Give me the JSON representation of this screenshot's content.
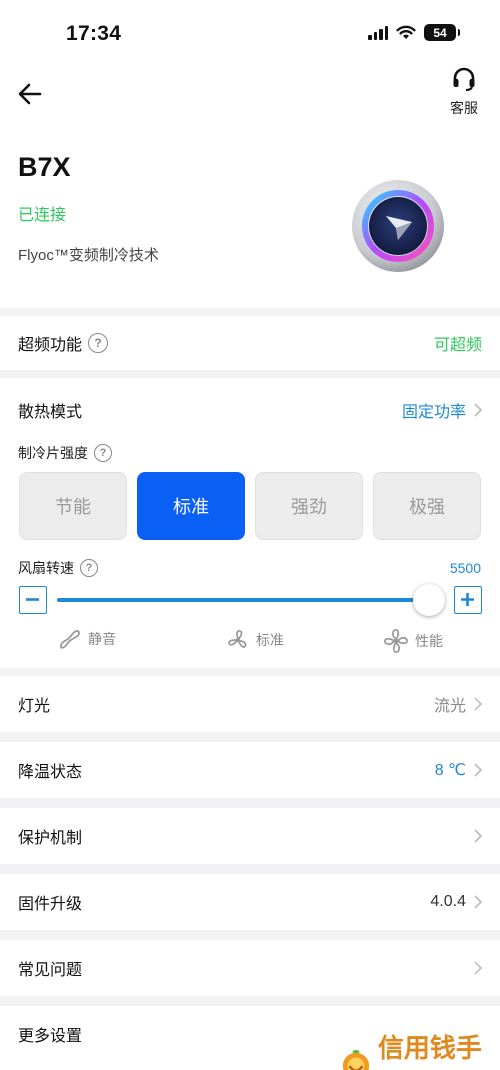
{
  "status_bar": {
    "time": "17:34",
    "battery": "54"
  },
  "header": {
    "support_label": "客服",
    "device_name": "B7X",
    "connection_status": "已连接",
    "technology": "Flyoc™变频制冷技术"
  },
  "overclock": {
    "label": "超频功能",
    "value": "可超频",
    "value_color": "#2ec95c"
  },
  "cooling_mode": {
    "label": "散热模式",
    "value": "固定功率",
    "intensity_label": "制冷片强度",
    "intensity_options": [
      "节能",
      "标准",
      "强劲",
      "极强"
    ],
    "selected_intensity": "标准",
    "fan_label": "风扇转速",
    "fan_speed": "5500",
    "fan_modes": [
      "静音",
      "标准",
      "性能"
    ]
  },
  "settings": [
    {
      "label": "灯光",
      "value": "流光"
    },
    {
      "label": "降温状态",
      "value": "8 ℃"
    },
    {
      "label": "保护机制",
      "value": ""
    },
    {
      "label": "固件升级",
      "value": "4.0.4"
    },
    {
      "label": "常见问题",
      "value": ""
    },
    {
      "label": "更多设置",
      "value": ""
    }
  ],
  "watermark": {
    "text": "信用钱手游"
  },
  "colors": {
    "accent_blue": "#1e88d8",
    "selected_blue": "#0a5ff5",
    "green": "#2ec95c"
  }
}
